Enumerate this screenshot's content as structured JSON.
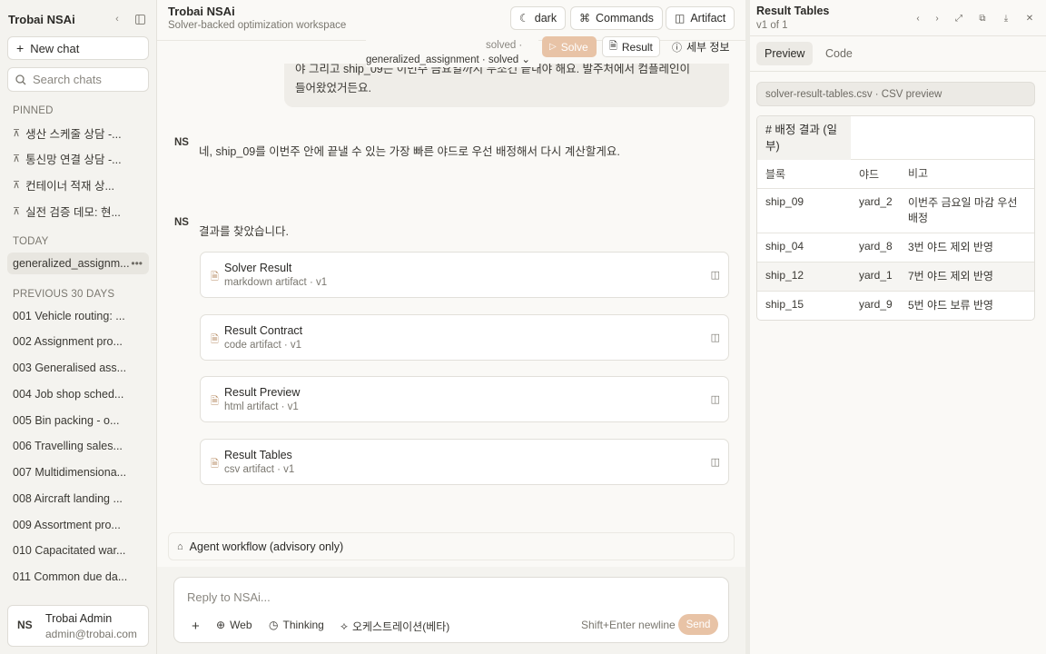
{
  "sidebar": {
    "title": "Trobai NSAi",
    "new_chat": "New chat",
    "search_placeholder": "Search chats",
    "pinned_label": "PINNED",
    "pinned": [
      "생산 스케줄 상담 -...",
      "통신망 연결 상담 -...",
      "컨테이너 적재 상...",
      "실전 검증 데모: 현..."
    ],
    "today_label": "TODAY",
    "today": [
      "generalized_assignm..."
    ],
    "prev_label": "PREVIOUS 30 DAYS",
    "previous": [
      "001 Vehicle routing: ...",
      "002 Assignment pro...",
      "003 Generalised ass...",
      "004 Job shop sched...",
      "005 Bin packing - o...",
      "006 Travelling sales...",
      "007 Multidimensiona...",
      "008 Aircraft landing ...",
      "009 Assortment pro...",
      "010 Capacitated war...",
      "011 Common due da..."
    ],
    "user": {
      "initials": "NS",
      "name": "Trobai Admin",
      "email": "admin@trobai.com"
    }
  },
  "header": {
    "title": "Trobai NSAi",
    "subtitle": "Solver-backed optimization workspace",
    "btn_dark": "dark",
    "btn_commands": "Commands",
    "btn_artifact": "Artifact"
  },
  "subbar": {
    "solved_small": "solved ·",
    "model": "generalized_assignment · solved",
    "solve": "Solve",
    "result": "Result",
    "detail": "세부 정보"
  },
  "chat": {
    "user_msg_line1": "야 그리고 ship_09는 이번주 금요일까지 무조건 끝내야 해요. 발주처에서 컴플레인이",
    "user_msg_line2": "들어왔었거든요.",
    "assistant_initials": "NS",
    "reply1": "네, ship_09를 이번주 안에 끝낼 수 있는 가장 빠른 야드로 우선 배정해서 다시 계산할게요.",
    "reply2": "결과를 찾았습니다.",
    "artifacts": [
      {
        "title": "Solver Result",
        "sub": "markdown artifact · v1"
      },
      {
        "title": "Result Contract",
        "sub": "code artifact · v1"
      },
      {
        "title": "Result Preview",
        "sub": "html artifact · v1"
      },
      {
        "title": "Result Tables",
        "sub": "csv artifact · v1"
      }
    ],
    "workflow": "Agent workflow (advisory only)"
  },
  "composer": {
    "placeholder": "Reply to NSAi...",
    "plus": "+",
    "web": "Web",
    "thinking": "Thinking",
    "orchestration": "오케스트레이션(베타)",
    "hint": "Shift+Enter newline",
    "send": "Send"
  },
  "panel": {
    "title": "Result Tables",
    "version": "v1 of 1",
    "tab_preview": "Preview",
    "tab_code": "Code",
    "csv_label": "solver-result-tables.csv · CSV preview",
    "caption": "# 배정 결과 (일부)",
    "columns": [
      "블록",
      "야드",
      "비고"
    ],
    "rows": [
      [
        "ship_09",
        "yard_2",
        "이번주 금요일 마감 우선 배정"
      ],
      [
        "ship_04",
        "yard_8",
        "3번 야드 제외 반영"
      ],
      [
        "ship_12",
        "yard_1",
        "7번 야드 제외 반영"
      ],
      [
        "ship_15",
        "yard_9",
        "5번 야드 보류 반영"
      ]
    ]
  },
  "colors": {
    "accent": "#e8c3a6",
    "sidebar_bg": "#f4f3ef",
    "page_bg": "#faf9f6"
  }
}
